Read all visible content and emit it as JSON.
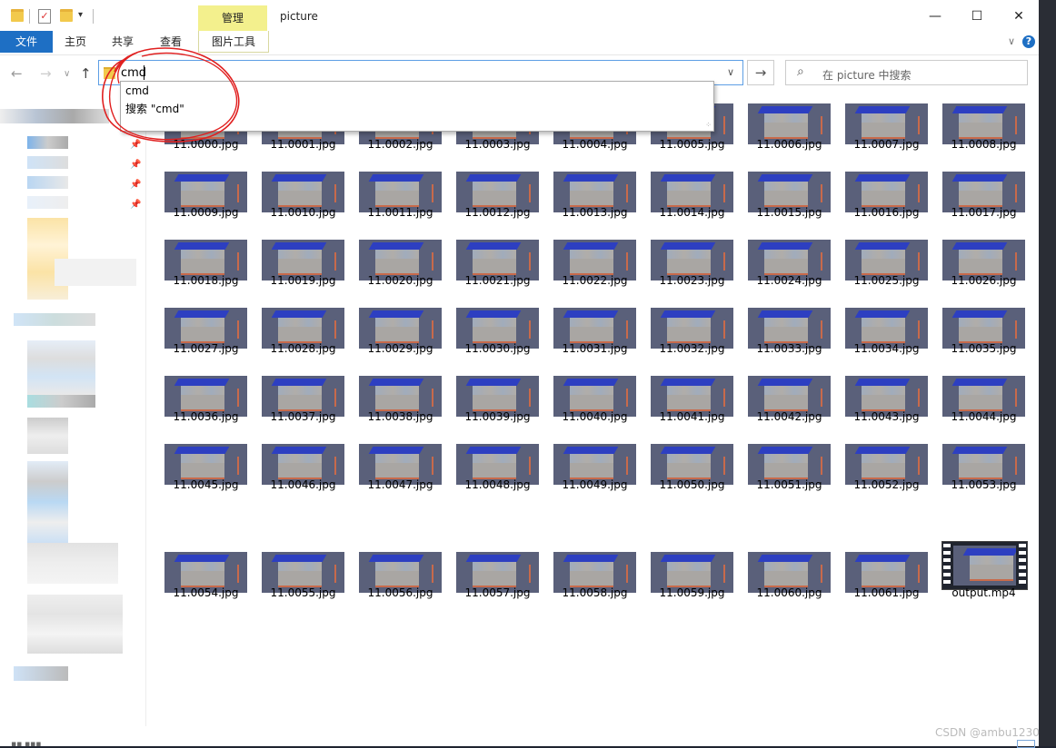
{
  "window": {
    "title": "picture"
  },
  "ribbon": {
    "context_group": "管理",
    "tabs": [
      {
        "label": "文件"
      },
      {
        "label": "主页"
      },
      {
        "label": "共享"
      },
      {
        "label": "查看"
      },
      {
        "label": "图片工具"
      }
    ],
    "help": "?"
  },
  "address": {
    "value": "cmd",
    "search_placeholder": "在 picture 中搜索"
  },
  "suggestions": [
    "cmd",
    "搜索 \"cmd\""
  ],
  "files": [
    "11.0000.jpg",
    "11.0001.jpg",
    "11.0002.jpg",
    "11.0003.jpg",
    "11.0004.jpg",
    "11.0005.jpg",
    "11.0006.jpg",
    "11.0007.jpg",
    "11.0008.jpg",
    "11.0009.jpg",
    "11.0010.jpg",
    "11.0011.jpg",
    "11.0012.jpg",
    "11.0013.jpg",
    "11.0014.jpg",
    "11.0015.jpg",
    "11.0016.jpg",
    "11.0017.jpg",
    "11.0018.jpg",
    "11.0019.jpg",
    "11.0020.jpg",
    "11.0021.jpg",
    "11.0022.jpg",
    "11.0023.jpg",
    "11.0024.jpg",
    "11.0025.jpg",
    "11.0026.jpg",
    "11.0027.jpg",
    "11.0028.jpg",
    "11.0029.jpg",
    "11.0030.jpg",
    "11.0031.jpg",
    "11.0032.jpg",
    "11.0033.jpg",
    "11.0034.jpg",
    "11.0035.jpg",
    "11.0036.jpg",
    "11.0037.jpg",
    "11.0038.jpg",
    "11.0039.jpg",
    "11.0040.jpg",
    "11.0041.jpg",
    "11.0042.jpg",
    "11.0043.jpg",
    "11.0044.jpg",
    "11.0045.jpg",
    "11.0046.jpg",
    "11.0047.jpg",
    "11.0048.jpg",
    "11.0049.jpg",
    "11.0050.jpg",
    "11.0051.jpg",
    "11.0052.jpg",
    "11.0053.jpg",
    "11.0054.jpg",
    "11.0055.jpg",
    "11.0056.jpg",
    "11.0057.jpg",
    "11.0058.jpg",
    "11.0059.jpg",
    "11.0060.jpg",
    "11.0061.jpg",
    "output.mp4"
  ],
  "watermark": "CSDN @ambu1230",
  "colors": {
    "accent": "#1e6fc4",
    "context_tab": "#f3f08d",
    "annotation": "#e02020"
  }
}
